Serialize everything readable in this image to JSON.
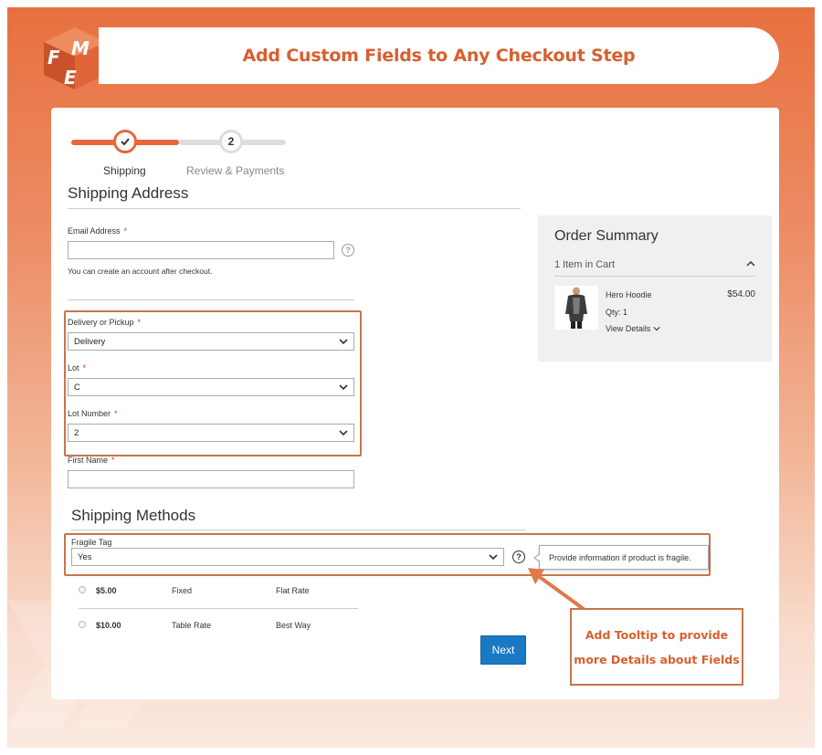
{
  "banner": {
    "title": "Add Custom Fields to Any Checkout Step",
    "logo_text": "FME"
  },
  "progress": {
    "steps": [
      {
        "label": "Shipping",
        "marker": "✓",
        "state": "complete"
      },
      {
        "label": "Review & Payments",
        "marker": "2",
        "state": "pending"
      }
    ]
  },
  "shipping_address": {
    "title": "Shipping Address",
    "email_label": "Email Address",
    "required_mark": "*",
    "email_value": "",
    "email_note": "You can create an account after checkout.",
    "delivery_label": "Delivery or Pickup",
    "delivery_value": "Delivery",
    "lot_label": "Lot",
    "lot_value": "C",
    "lot_number_label": "Lot Number",
    "lot_number_value": "2",
    "first_name_label": "First Name",
    "first_name_value": ""
  },
  "order_summary": {
    "title": "Order Summary",
    "items_in_cart": "1 Item in Cart",
    "product_name": "Hero Hoodie",
    "product_price": "$54.00",
    "product_qty": "Qty: 1",
    "view_details": "View Details"
  },
  "shipping_methods": {
    "title": "Shipping Methods",
    "fragile_label": "Fragile Tag",
    "fragile_value": "Yes",
    "tooltip": "Provide information if product is fragile.",
    "rows": [
      {
        "price": "$5.00",
        "method": "Fixed",
        "carrier": "Flat Rate"
      },
      {
        "price": "$10.00",
        "method": "Table Rate",
        "carrier": "Best Way"
      }
    ],
    "next_label": "Next"
  },
  "callout": {
    "line1": "Add Tooltip to provide",
    "line2": "more Details about Fields"
  },
  "colors": {
    "accent": "#e8663a",
    "title": "#d85f2f",
    "button": "#1979c3",
    "required": "#e02b27"
  },
  "icons": [
    "check-icon",
    "help-icon",
    "chevron-down-icon",
    "chevron-up-icon"
  ]
}
